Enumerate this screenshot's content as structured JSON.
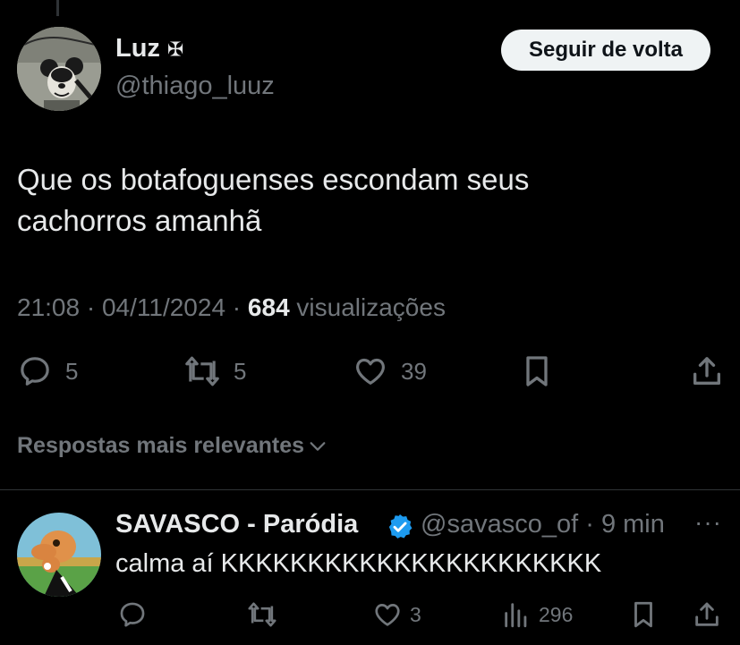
{
  "tweet": {
    "author_name": "Luz",
    "author_badge": "✠",
    "author_handle": "@thiago_luuz",
    "follow_label": "Seguir de volta",
    "text": "Que os botafoguenses escondam seus cachorros amanhã",
    "time": "21:08",
    "separator": " · ",
    "date": "04/11/2024",
    "views_count": "684",
    "views_label": "visualizações",
    "replies": "5",
    "reposts": "5",
    "likes": "39"
  },
  "replies_section": {
    "sort_label": "Respostas mais relevantes"
  },
  "reply": {
    "author_name": "SAVASCO - Paródia",
    "author_handle": "@savasco_of",
    "time_sep": "·",
    "time": "9 min",
    "more": "···",
    "text": "calma aí KKKKKKKKKKKKKKKKKKKKKK",
    "likes": "3",
    "views": "296"
  },
  "colors": {
    "background": "#000000",
    "text_primary": "#e7e9ea",
    "text_secondary": "#71767b",
    "verified": "#1d9bf0",
    "button_bg": "#eff3f4"
  }
}
